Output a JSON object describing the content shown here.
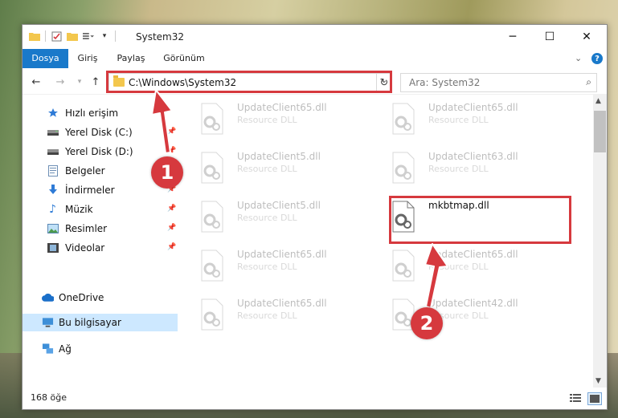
{
  "window": {
    "title": "System32",
    "controls": {
      "minimize": "─",
      "maximize": "☐",
      "close": "✕"
    }
  },
  "ribbon": {
    "tabs": [
      {
        "label": "Dosya",
        "active": true
      },
      {
        "label": "Giriş"
      },
      {
        "label": "Paylaş"
      },
      {
        "label": "Görünüm"
      }
    ],
    "collapse_icon": "chevron-down-icon",
    "help_icon": "help-icon"
  },
  "address_bar": {
    "path": "C:\\Windows\\System32"
  },
  "search": {
    "placeholder": "Ara: System32"
  },
  "navigation": {
    "items": [
      {
        "label": "Hızlı erişim",
        "icon": "star-icon",
        "pinned": false
      },
      {
        "label": "Yerel Disk (C:)",
        "icon": "drive-icon",
        "pinned": true
      },
      {
        "label": "Yerel Disk (D:)",
        "icon": "drive-icon",
        "pinned": true
      },
      {
        "label": "Belgeler",
        "icon": "document-icon",
        "pinned": true
      },
      {
        "label": "İndirmeler",
        "icon": "download-icon",
        "pinned": true
      },
      {
        "label": "Müzik",
        "icon": "music-icon",
        "pinned": true
      },
      {
        "label": "Resimler",
        "icon": "picture-icon",
        "pinned": true
      },
      {
        "label": "Videolar",
        "icon": "video-icon",
        "pinned": true
      },
      {
        "label": "OneDrive",
        "icon": "cloud-icon",
        "pinned": false
      },
      {
        "label": "Bu bilgisayar",
        "icon": "computer-icon",
        "pinned": false,
        "selected": true
      },
      {
        "label": "Ağ",
        "icon": "network-icon",
        "pinned": false
      }
    ]
  },
  "files": [
    {
      "name": "UpdateClient65.dll",
      "type": "Resource DLL",
      "faded": true
    },
    {
      "name": "UpdateClient65.dll",
      "type": "Resource DLL",
      "faded": true
    },
    {
      "name": "UpdateClient5.dll",
      "type": "Resource DLL",
      "faded": true
    },
    {
      "name": "UpdateClient63.dll",
      "type": "Resource DLL",
      "faded": true
    },
    {
      "name": "UpdateClient5.dll",
      "type": "Resource DLL",
      "faded": true
    },
    {
      "name": "mkbtmap.dll",
      "type": "",
      "faded": false
    },
    {
      "name": "UpdateClient65.dll",
      "type": "Resource DLL",
      "faded": true
    },
    {
      "name": "UpdateClient65.dll",
      "type": "Resource DLL",
      "faded": true
    },
    {
      "name": "UpdateClient65.dll",
      "type": "Resource DLL",
      "faded": true
    },
    {
      "name": "UpdateClient42.dll",
      "type": "Resource DLL",
      "faded": true
    }
  ],
  "status_bar": {
    "item_count": "168 öğe"
  },
  "annotations": {
    "badge1": "1",
    "badge2": "2",
    "color": "#d6393e"
  }
}
